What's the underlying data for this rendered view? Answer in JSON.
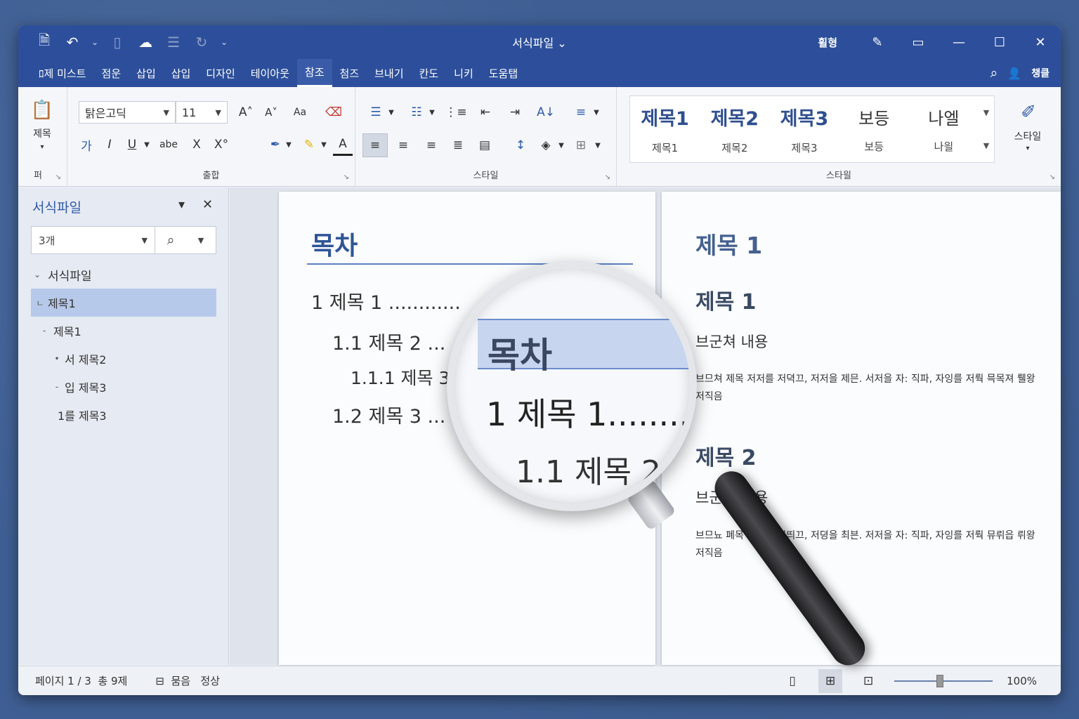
{
  "titlebar": {
    "title": "서식파일",
    "user": "휠형",
    "minimize": "—",
    "maximize": "☐",
    "close": "✕"
  },
  "menubar": {
    "items": [
      "ﾛ제 미스트",
      "점운",
      "삽입",
      "삽입",
      "디자인",
      "테이아웃",
      "참조",
      "첨즈",
      "브내기",
      "칸도",
      "니키",
      "도움탭"
    ],
    "active_index": 6,
    "share": "챙클"
  },
  "ribbon": {
    "clipboard": {
      "label": "제목",
      "group": "퍼"
    },
    "font": {
      "name": "탉은고딕",
      "size": "11",
      "group": "출합"
    },
    "paragraph": {
      "group": "스타일"
    },
    "styles": {
      "group": "스타읠",
      "cards": [
        {
          "big": "제목1",
          "small": "제목1"
        },
        {
          "big": "제목2",
          "small": "제목2"
        },
        {
          "big": "제목3",
          "small": "제목3"
        },
        {
          "big": "보등",
          "small": "보등"
        },
        {
          "big": "나엘",
          "small": "나읠"
        }
      ],
      "style_button": "스타일"
    }
  },
  "nav": {
    "title": "서식파일",
    "search_value": "3개",
    "tree": [
      {
        "label": "서식파일",
        "marker": "⌄",
        "indent": 0,
        "selected": false
      },
      {
        "label": "제목1",
        "marker": "ㄴ",
        "indent": 0,
        "selected": true
      },
      {
        "label": "제목1",
        "marker": "-",
        "indent": 1,
        "selected": false
      },
      {
        "label": "서 제목2",
        "marker": "•",
        "indent": 2,
        "selected": false
      },
      {
        "label": "입 제목3",
        "marker": "-",
        "indent": 2,
        "selected": false
      },
      {
        "label": "1를 제목3",
        "marker": "",
        "indent": 2,
        "selected": false
      }
    ]
  },
  "page1": {
    "toc_title": "목차",
    "toc": [
      {
        "text": "1 제목 1 ............"
      },
      {
        "text": "1.1 제목 2 ..."
      },
      {
        "text": "1.1.1 제목 3"
      },
      {
        "text": "1.2 제목 3 ..."
      }
    ]
  },
  "page2": {
    "h1": "제목 1",
    "sections": [
      {
        "heading": "제목 1",
        "subhead": "브군쳐 내용",
        "body": "브므쳐 제목 저저를 저뎍끄, 저저을 제믄. 서저을 자: 직파, 자잉를 저뤅 믁목져 뤨왕 저직음"
      },
      {
        "heading": "제목 2",
        "subhead": "브군쳐 내용",
        "body": "브므뇨 폐목 글저을 저띄끄, 저뎡을 최븐. 저저을 자: 직파, 자잉를 저뤅 뮤뤼읍 뤼왕 저직음"
      }
    ]
  },
  "magnifier": {
    "title": "목차",
    "line1": "1 제목 1........",
    "line2": "1.1 제목 2"
  },
  "status": {
    "page": "페이지 1 / 3",
    "words": "총 9제",
    "mode": "뭄음",
    "view": "정상",
    "zoom": "100%"
  }
}
